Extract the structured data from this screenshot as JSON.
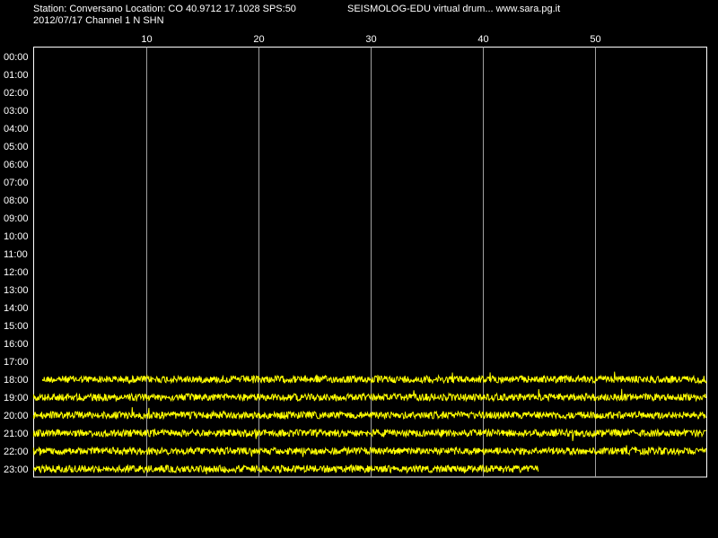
{
  "header": {
    "station_line": "Station: Conversano Location: CO 40.9712 17.1028 SPS:50",
    "product_line": "SEISMOLOG-EDU virtual drum... www.sara.pg.it",
    "date_line": "2012/07/17  Channel 1 N SHN"
  },
  "colors": {
    "background": "#000000",
    "plot_border": "#ffffff",
    "grid": "#a0a0a0",
    "trace": "#ffff00",
    "text": "#ffffff"
  },
  "chart_data": {
    "type": "line",
    "title": "",
    "xlabel": "",
    "ylabel": "",
    "xlim": [
      0,
      60
    ],
    "x_ticks": [
      10,
      20,
      30,
      40,
      50
    ],
    "grid": true,
    "rows": [
      "00:00",
      "01:00",
      "02:00",
      "03:00",
      "04:00",
      "05:00",
      "06:00",
      "07:00",
      "08:00",
      "09:00",
      "10:00",
      "11:00",
      "12:00",
      "13:00",
      "14:00",
      "15:00",
      "16:00",
      "17:00",
      "18:00",
      "19:00",
      "20:00",
      "21:00",
      "22:00",
      "23:00"
    ],
    "traces": [
      {
        "row": "18:00",
        "start_min": 0.8,
        "end_min": 60
      },
      {
        "row": "19:00",
        "start_min": 0,
        "end_min": 60
      },
      {
        "row": "20:00",
        "start_min": 0,
        "end_min": 60
      },
      {
        "row": "21:00",
        "start_min": 0,
        "end_min": 60
      },
      {
        "row": "22:00",
        "start_min": 0,
        "end_min": 60
      },
      {
        "row": "23:00",
        "start_min": 0,
        "end_min": 45
      }
    ]
  }
}
